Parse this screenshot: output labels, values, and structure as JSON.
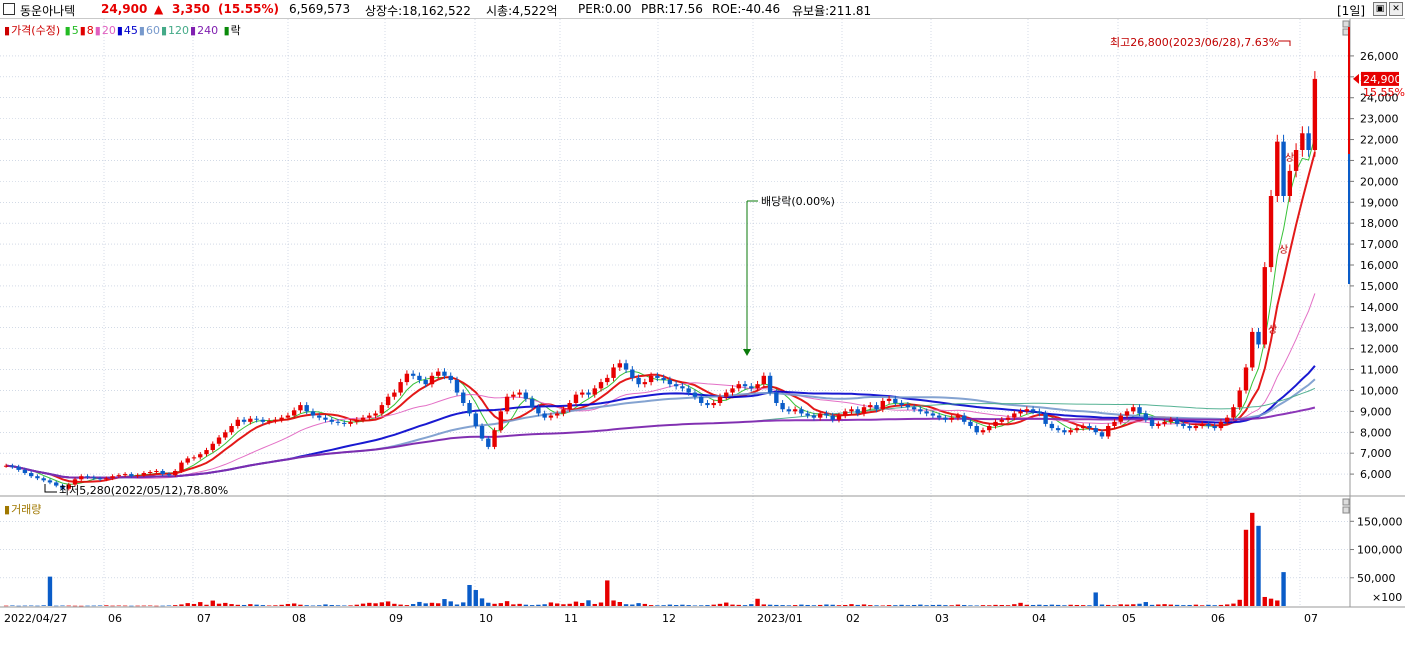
{
  "header": {
    "stock_name": "동운아나텍",
    "price": "24,900",
    "change_arrow": "▲",
    "change": "3,350",
    "change_pct": "(15.55%)",
    "volume": "6,569,573",
    "shares": "상장수:18,162,522",
    "market_cap": "시총:4,522억",
    "per": "PER:0.00",
    "pbr": "PBR:17.56",
    "roe": "ROE:-40.46",
    "reserve": "유보율:211.81",
    "period": "[1일]",
    "up_color": "#e60000",
    "down_color": "#0a5cc8"
  },
  "price_legend": {
    "title": "가격(수정)",
    "ma": [
      {
        "label": "5",
        "color": "#22bb22"
      },
      {
        "label": "8",
        "color": "#e00000"
      },
      {
        "label": "20",
        "color": "#e060c0"
      },
      {
        "label": "45",
        "color": "#0000cc"
      },
      {
        "label": "60",
        "color": "#7799cc"
      },
      {
        "label": "120",
        "color": "#44aa88"
      },
      {
        "label": "240",
        "color": "#8020b0"
      }
    ],
    "ex_label": "락"
  },
  "volume_legend": {
    "title": "거래량",
    "unit": "×100"
  },
  "annotations": {
    "high": "최고26,800(2023/06/28),7.63%",
    "low": "최저5,280(2022/05/12),78.80%",
    "dividend": "배당락(0.00%)",
    "up_limit": "상"
  },
  "chart_data": {
    "type": "candlestick",
    "ylim": [
      5000,
      27000
    ],
    "price_ticks": [
      "26,000",
      "25,000",
      "24,000",
      "23,000",
      "22,000",
      "21,000",
      "20,000",
      "19,000",
      "18,000",
      "17,000",
      "16,000",
      "15,000",
      "14,000",
      "13,000",
      "12,000",
      "11,000",
      "10,000",
      "9,000",
      "8,000",
      "7,000",
      "6,000"
    ],
    "current_price_label": "24,900",
    "current_pct_label": "15.55%",
    "volume_ylim": [
      0,
      170000
    ],
    "volume_ticks": [
      "150,000",
      "100,000",
      "50,000"
    ],
    "x_labels": [
      "2022/04/27",
      "06",
      "07",
      "08",
      "09",
      "10",
      "11",
      "12",
      "2023/01",
      "02",
      "03",
      "04",
      "05",
      "06",
      "07"
    ],
    "closes": [
      6400,
      6350,
      6200,
      6050,
      5900,
      5800,
      5700,
      5600,
      5450,
      5300,
      5500,
      5750,
      5900,
      5850,
      5800,
      5750,
      5800,
      5900,
      5950,
      6000,
      5900,
      5950,
      6050,
      6100,
      6150,
      6000,
      5950,
      6150,
      6550,
      6750,
      6800,
      6950,
      7150,
      7450,
      7750,
      8000,
      8300,
      8600,
      8500,
      8650,
      8600,
      8500,
      8550,
      8600,
      8700,
      8800,
      9050,
      9300,
      9000,
      8800,
      8700,
      8600,
      8500,
      8450,
      8400,
      8500,
      8600,
      8700,
      8800,
      8900,
      9300,
      9700,
      9900,
      10400,
      10800,
      10700,
      10500,
      10300,
      10700,
      10900,
      10700,
      10500,
      9900,
      9400,
      8900,
      8300,
      7700,
      7300,
      8100,
      9000,
      9700,
      9800,
      9900,
      9600,
      9200,
      8900,
      8700,
      8800,
      8900,
      9100,
      9400,
      9800,
      9900,
      9800,
      10100,
      10400,
      10600,
      11100,
      11300,
      11000,
      10600,
      10300,
      10400,
      10700,
      10600,
      10500,
      10300,
      10200,
      10100,
      9900,
      9700,
      9400,
      9300,
      9400,
      9700,
      9900,
      10100,
      10300,
      10200,
      10100,
      10300,
      10700,
      9900,
      9400,
      9100,
      9000,
      9100,
      8900,
      8800,
      8700,
      8900,
      8800,
      8600,
      8800,
      9000,
      9100,
      8900,
      9200,
      9300,
      9100,
      9500,
      9600,
      9400,
      9300,
      9200,
      9100,
      9000,
      8900,
      8800,
      8700,
      8600,
      8700,
      8800,
      8500,
      8300,
      8000,
      8100,
      8300,
      8500,
      8600,
      8700,
      8900,
      9000,
      9100,
      9000,
      8900,
      8400,
      8200,
      8100,
      8000,
      8100,
      8200,
      8300,
      8200,
      8000,
      7800,
      8300,
      8500,
      8800,
      9000,
      9200,
      8900,
      8600,
      8300,
      8400,
      8500,
      8600,
      8400,
      8300,
      8200,
      8300,
      8400,
      8300,
      8200,
      8500,
      8700,
      9200,
      10000,
      11100,
      12800,
      12200,
      15900,
      19300,
      21900,
      19300,
      20500,
      21500,
      22300,
      21500,
      24900
    ],
    "high_point": {
      "date": "2023/06/28",
      "value": 26800
    },
    "low_point": {
      "date": "2022/05/12",
      "value": 5280
    },
    "volumes": [
      600,
      900,
      500,
      700,
      800,
      600,
      1200,
      52000,
      600,
      800,
      700,
      500,
      400,
      600,
      700,
      900,
      1200,
      600,
      800,
      700,
      500,
      600,
      700,
      800,
      500,
      600,
      900,
      1500,
      2800,
      5100,
      3600,
      6900,
      2200,
      9600,
      4100,
      5500,
      3400,
      2100,
      1800,
      3300,
      2400,
      1600,
      900,
      1200,
      2100,
      3600,
      4500,
      2300,
      1400,
      800,
      1300,
      2800,
      1700,
      1200,
      900,
      1100,
      2300,
      4200,
      5600,
      4800,
      6500,
      8100,
      3900,
      2500,
      1600,
      3500,
      7200,
      4700,
      5700,
      4800,
      12300,
      8200,
      2700,
      6400,
      37200,
      28300,
      13500,
      5800,
      3900,
      5100,
      8600,
      2900,
      3800,
      2300,
      1600,
      2200,
      3100,
      6300,
      4500,
      3100,
      3900,
      7800,
      5400,
      10100,
      3600,
      6200,
      45300,
      9800,
      7100,
      3200,
      2600,
      5100,
      3700,
      1600,
      1200,
      1400,
      2500,
      1700,
      2300,
      1600,
      900,
      1200,
      1600,
      2400,
      3800,
      6100,
      2500,
      2000,
      1500,
      3300,
      12800,
      2800,
      2300,
      1900,
      1600,
      1200,
      1600,
      2500,
      1800,
      1300,
      1900,
      2700,
      2200,
      1400,
      1800,
      3300,
      1900,
      2800,
      1600,
      1200,
      900,
      1600,
      1400,
      2100,
      1300,
      1800,
      2500,
      1300,
      1800,
      2100,
      1500,
      1300,
      2500,
      1700,
      1100,
      900,
      1500,
      1300,
      2000,
      1800,
      1400,
      3200,
      5600,
      2100,
      1800,
      2300,
      1700,
      2400,
      1900,
      1300,
      2200,
      1800,
      1500,
      1300,
      24000,
      2600,
      1900,
      1200,
      3000,
      2500,
      3100,
      4000,
      7000,
      2000,
      2700,
      3300,
      2500,
      2000,
      1500,
      1800,
      2400,
      1200,
      2100,
      1400,
      1900,
      2800,
      4300,
      11000,
      135000,
      165000,
      142000,
      16000,
      13000,
      9800,
      60000
    ]
  }
}
